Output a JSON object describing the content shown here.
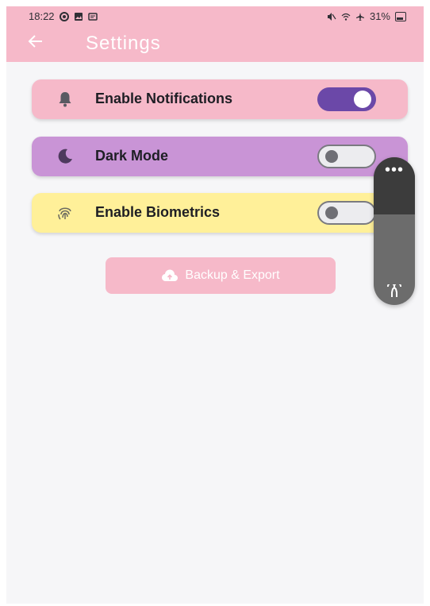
{
  "status_bar": {
    "time": "18:22",
    "battery": "31%"
  },
  "app_bar": {
    "title": "Settings",
    "back_icon": "arrow-left-icon"
  },
  "settings": [
    {
      "label": "Enable Notifications",
      "icon": "bell-icon",
      "toggle_on": true,
      "color": "#f6b9c9"
    },
    {
      "label": "Dark Mode",
      "icon": "moon-icon",
      "toggle_on": false,
      "color": "#c994d6"
    },
    {
      "label": "Enable Biometrics",
      "icon": "fingerprint-icon",
      "toggle_on": false,
      "color": "#fff099"
    }
  ],
  "backup_button": {
    "label": "Backup & Export",
    "icon": "cloud-upload-icon"
  },
  "volume_panel": {
    "more_icon": "more-horizontal-icon",
    "device_icon": "earbuds-icon",
    "level_fraction": 0.65
  },
  "colors": {
    "accent": "#6b48a8",
    "app_bar": "#f6b9c9",
    "background": "#f6f6f8"
  }
}
